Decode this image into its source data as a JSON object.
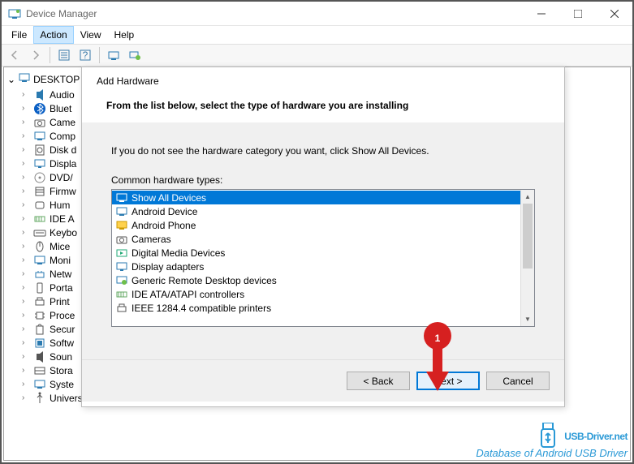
{
  "window": {
    "title": "Device Manager"
  },
  "menu": {
    "file": "File",
    "action": "Action",
    "view": "View",
    "help": "Help"
  },
  "tree": {
    "root": "DESKTOP",
    "items": [
      {
        "label": "Audio",
        "icon": "speaker"
      },
      {
        "label": "Bluet",
        "icon": "bluetooth"
      },
      {
        "label": "Came",
        "icon": "camera"
      },
      {
        "label": "Comp",
        "icon": "computer"
      },
      {
        "label": "Disk d",
        "icon": "disk"
      },
      {
        "label": "Displa",
        "icon": "display"
      },
      {
        "label": "DVD/",
        "icon": "dvd"
      },
      {
        "label": "Firmw",
        "icon": "firmware"
      },
      {
        "label": "Hum",
        "icon": "hid"
      },
      {
        "label": "IDE A",
        "icon": "ide"
      },
      {
        "label": "Keybo",
        "icon": "keyboard"
      },
      {
        "label": "Mice",
        "icon": "mouse"
      },
      {
        "label": "Moni",
        "icon": "monitor"
      },
      {
        "label": "Netw",
        "icon": "network"
      },
      {
        "label": "Porta",
        "icon": "portable"
      },
      {
        "label": "Print",
        "icon": "printer"
      },
      {
        "label": "Proce",
        "icon": "processor"
      },
      {
        "label": "Secur",
        "icon": "security"
      },
      {
        "label": "Softw",
        "icon": "software"
      },
      {
        "label": "Soun",
        "icon": "sound"
      },
      {
        "label": "Stora",
        "icon": "storage"
      },
      {
        "label": "Syste",
        "icon": "system"
      },
      {
        "label": "Universal Serial Bus controllers",
        "icon": "usb"
      }
    ]
  },
  "dialog": {
    "title": "Add Hardware",
    "heading": "From the list below, select the type of hardware you are installing",
    "note": "If you do not see the hardware category you want, click Show All Devices.",
    "list_label": "Common hardware types:",
    "items": [
      {
        "label": "Show All Devices",
        "icon": "monitor",
        "selected": true
      },
      {
        "label": "Android Device",
        "icon": "monitor"
      },
      {
        "label": "Android Phone",
        "icon": "monitor-y"
      },
      {
        "label": "Cameras",
        "icon": "camera"
      },
      {
        "label": "Digital Media Devices",
        "icon": "media"
      },
      {
        "label": "Display adapters",
        "icon": "display"
      },
      {
        "label": "Generic Remote Desktop devices",
        "icon": "remote"
      },
      {
        "label": "IDE ATA/ATAPI controllers",
        "icon": "ide"
      },
      {
        "label": "IEEE 1284.4 compatible printers",
        "icon": "printer"
      }
    ],
    "back": "< Back",
    "next": "Next >",
    "cancel": "Cancel"
  },
  "callout": {
    "num": "1"
  },
  "watermark": {
    "main": "USB-Driver.net",
    "sub": "Database of Android USB Driver"
  }
}
